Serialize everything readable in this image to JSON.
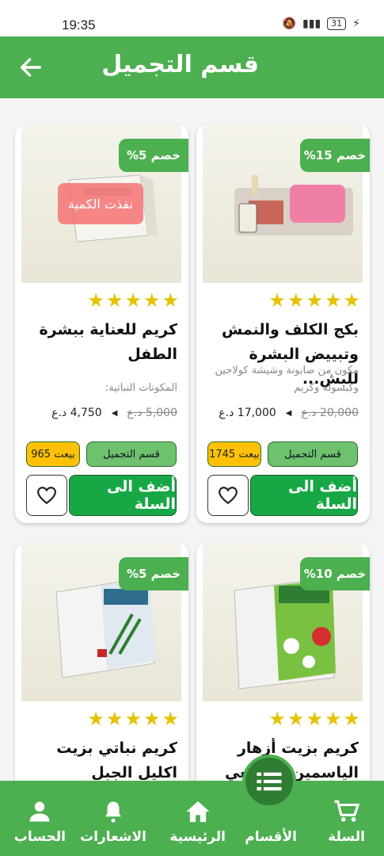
{
  "status": {
    "time": "19:35",
    "battery": "31"
  },
  "header": {
    "title": "قسم التجميل"
  },
  "products": [
    {
      "discount": "خصم 15%",
      "title": "بكج الكلف والنمش وتبييض البشرة للبش...",
      "description": "مكون من صابونة وشيشة كولاجين وكبسولة وكريم",
      "old_price": "20,000 د.ع",
      "new_price": "17,000 د.ع",
      "category": "قسم التجميل",
      "sold": "بيعت 1745",
      "add_label": "أضف الى السلة",
      "stars": "★★★★★"
    },
    {
      "discount": "خصم 5%",
      "title": "كريم للعناية ببشرة الطفل",
      "description": "المكونات النباتية:",
      "old_price": "5,000 د.ع",
      "new_price": "4,750 د.ع",
      "category": "قسم التجميل",
      "sold": "بيعت 965",
      "add_label": "أضف الى السلة",
      "stars": "★★★★★",
      "out_of_stock": "نفذت الكمية"
    },
    {
      "discount": "خصم 10%",
      "title": "كريم بزيت أزهار الياسمين الطبيعي الد...",
      "stars": "★★★★★"
    },
    {
      "discount": "خصم 5%",
      "title": "كريم نباتي بزيت اكليل الجبل",
      "stars": "★★★★★"
    }
  ],
  "nav": {
    "cart": "السلة",
    "categories": "الأقسام",
    "home": "الرئيسية",
    "notifications": "الاشعارات",
    "account": "الحساب"
  },
  "colors": {
    "primary": "#4caf50",
    "button": "#17a845",
    "star": "#e6c200",
    "sold": "#ffc107"
  }
}
